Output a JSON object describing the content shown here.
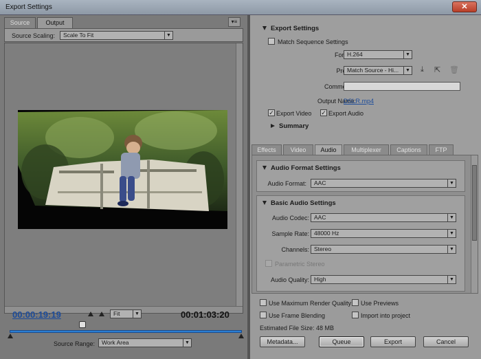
{
  "window": {
    "title": "Export Settings",
    "close_glyph": "✕"
  },
  "left": {
    "tabs": [
      "Source",
      "Output"
    ],
    "panel_menu_glyph": "▾≡",
    "source_scaling": {
      "label": "Source Scaling:",
      "value": "Scale To Fit"
    },
    "current_time": "00:00:19:19",
    "duration": "00:01:03:20",
    "zoom": "Fit",
    "source_range": {
      "label": "Source Range:",
      "value": "Work Area"
    }
  },
  "export_settings": {
    "heading": "Export Settings",
    "match_sequence": {
      "label": "Match Sequence Settings",
      "checked": false
    },
    "format": {
      "label": "Format:",
      "value": "H.264"
    },
    "preset": {
      "label": "Preset:",
      "value": "Match Source - Hi..."
    },
    "comments": {
      "label": "Comments:",
      "value": ""
    },
    "output_name": {
      "label": "Output Name:",
      "value": "DSLR.mp4"
    },
    "export_video": {
      "label": "Export Video",
      "checked": true
    },
    "export_audio": {
      "label": "Export Audio",
      "checked": true
    },
    "summary": "Summary"
  },
  "tabs": [
    "Effects",
    "Video",
    "Audio",
    "Multiplexer",
    "Captions",
    "FTP"
  ],
  "active_tab": "Audio",
  "audio_format": {
    "heading": "Audio Format Settings",
    "label": "Audio Format:",
    "value": "AAC"
  },
  "basic_audio": {
    "heading": "Basic Audio Settings",
    "codec": {
      "label": "Audio Codec:",
      "value": "AAC"
    },
    "sample_rate": {
      "label": "Sample Rate:",
      "value": "48000 Hz"
    },
    "channels": {
      "label": "Channels:",
      "value": "Stereo"
    },
    "parametric_stereo": {
      "label": "Parametric Stereo",
      "checked": false
    },
    "quality": {
      "label": "Audio Quality:",
      "value": "High"
    }
  },
  "options": {
    "max_render": {
      "label": "Use Maximum Render Quality",
      "checked": false
    },
    "use_previews": {
      "label": "Use Previews",
      "checked": false
    },
    "frame_blending": {
      "label": "Use Frame Blending",
      "checked": false
    },
    "import_project": {
      "label": "Import into project",
      "checked": false
    },
    "file_size": "Estimated File Size:  48 MB"
  },
  "buttons": {
    "metadata": "Metadata...",
    "queue": "Queue",
    "export": "Export",
    "cancel": "Cancel"
  }
}
